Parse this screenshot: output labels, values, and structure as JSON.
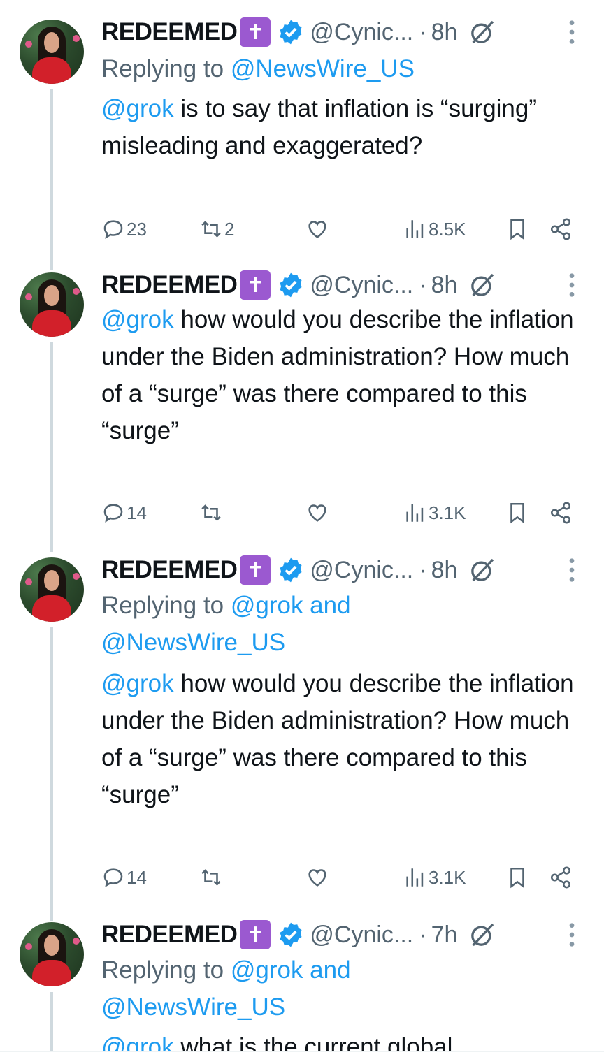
{
  "tweets": [
    {
      "name": "REDEEMED",
      "badge": "✝",
      "handle": "@Cynic...",
      "time": "8h",
      "reply_prefix": "Replying to",
      "reply_mentions": "@NewsWire_US",
      "reply_line2": "",
      "mention": "@grok",
      "text": " is to say that inflation is “surging” misleading and exaggerated?",
      "replies": "23",
      "reposts": "2",
      "likes": "",
      "views": "8.5K"
    },
    {
      "name": "REDEEMED",
      "badge": "✝",
      "handle": "@Cynic...",
      "time": "8h",
      "reply_prefix": "",
      "reply_mentions": "",
      "reply_line2": "",
      "mention": "@grok",
      "text": " how would you describe the inflation under the Biden administration? How much of a “surge” was there compared to this “surge”",
      "replies": "14",
      "reposts": "",
      "likes": "",
      "views": "3.1K"
    },
    {
      "name": "REDEEMED",
      "badge": "✝",
      "handle": "@Cynic...",
      "time": "8h",
      "reply_prefix": "Replying to",
      "reply_mentions": "@grok and",
      "reply_line2": "@NewsWire_US",
      "mention": "@grok",
      "text": " how would you describe the inflation under the Biden administration? How much of a “surge” was there compared to this “surge”",
      "replies": "14",
      "reposts": "",
      "likes": "",
      "views": "3.1K"
    },
    {
      "name": "REDEEMED",
      "badge": "✝",
      "handle": "@Cynic...",
      "time": "7h",
      "reply_prefix": "Replying to",
      "reply_mentions": "@grok and",
      "reply_line2": "@NewsWire_US",
      "mention": "@grok",
      "text": " what is the current global",
      "replies": "",
      "reposts": "",
      "likes": "",
      "views": ""
    }
  ],
  "separator": "·",
  "icons": {
    "reply": "reply-icon",
    "repost": "repost-icon",
    "like": "heart-icon",
    "views": "views-icon",
    "bookmark": "bookmark-icon",
    "share": "share-icon",
    "more": "more-icon",
    "verified": "verified-icon",
    "grok": "grok-icon"
  },
  "colors": {
    "accent": "#1d9bf0",
    "muted": "#536471",
    "badge": "#9b59d0"
  }
}
